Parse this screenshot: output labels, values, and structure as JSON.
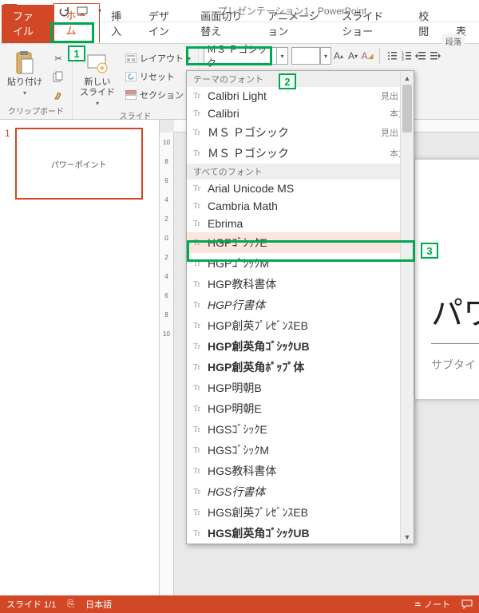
{
  "title": "プレゼンテーション1 - PowerPoint",
  "tabs": {
    "file": "ファイル",
    "home": "ホーム",
    "insert": "挿入",
    "design": "デザイン",
    "transition": "画面切り替え",
    "anim": "アニメーション",
    "slideshow": "スライド ショー",
    "review": "校閲",
    "view": "表"
  },
  "ribbon": {
    "clipboard": {
      "paste": "貼り付け",
      "label": "クリップボード"
    },
    "slides": {
      "new": "新しい\nスライド",
      "layout": "レイアウト",
      "reset": "リセット",
      "section": "セクション",
      "label": "スライド"
    },
    "font": {
      "name": "ＭＳ Ｐゴシック",
      "size": ""
    },
    "paragraph": {
      "label": "段落"
    }
  },
  "callouts": {
    "c1": "1",
    "c2": "2",
    "c3": "3"
  },
  "fontdrop": {
    "theme_header": "テーマのフォント",
    "theme": [
      {
        "name": "Calibri Light",
        "tag": "見出し"
      },
      {
        "name": "Calibri",
        "tag": "本文"
      },
      {
        "name": "ＭＳ Ｐゴシック",
        "tag": "見出し"
      },
      {
        "name": "ＭＳ Ｐゴシック",
        "tag": "本文"
      }
    ],
    "all_header": "すべてのフォント",
    "all": [
      "Arial Unicode MS",
      "Cambria Math",
      "Ebrima",
      "HGPｺﾞｼｯｸE",
      "HGPｺﾞｼｯｸM",
      "HGP教科書体",
      "HGP行書体",
      "HGP創英ﾌﾟﾚｾﾞﾝｽEB",
      "HGP創英角ｺﾞｼｯｸUB",
      "HGP創英角ﾎﾟｯﾌﾟ体",
      "HGP明朝B",
      "HGP明朝E",
      "HGSｺﾞｼｯｸE",
      "HGSｺﾞｼｯｸM",
      "HGS教科書体",
      "HGS行書体",
      "HGS創英ﾌﾟﾚｾﾞﾝｽEB",
      "HGS創英角ｺﾞｼｯｸUB"
    ],
    "selected_index": 3
  },
  "thumb": {
    "num": "1",
    "title": "パワーポイント"
  },
  "ruler_v": [
    "10",
    "8",
    "6",
    "4",
    "2",
    "0",
    "2",
    "4",
    "6",
    "8",
    "10"
  ],
  "canvas": {
    "title": "パワー",
    "sub": "サブタイ"
  },
  "status": {
    "slide": "スライド 1/1",
    "lang": "日本語",
    "notes": "ノート",
    "comments": ""
  }
}
